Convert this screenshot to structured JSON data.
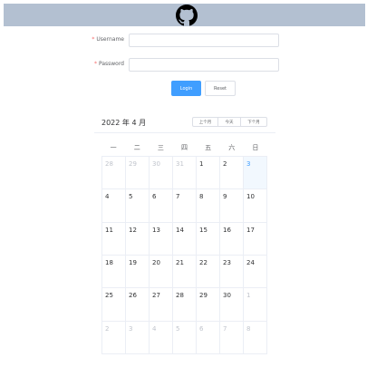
{
  "header": {
    "logo_icon": "github-icon",
    "bg_color": "#b3c0d1"
  },
  "form": {
    "username_label": "Username",
    "password_label": "Password",
    "required_mark": "*",
    "username_value": "",
    "password_value": "",
    "login_label": "Login",
    "reset_label": "Reset"
  },
  "calendar": {
    "title": "2022 年 4 月",
    "prev_label": "上个月",
    "today_label": "今天",
    "next_label": "下个月",
    "weekdays": [
      "一",
      "二",
      "三",
      "四",
      "五",
      "六",
      "日"
    ],
    "days": [
      {
        "d": "28",
        "other": true
      },
      {
        "d": "29",
        "other": true
      },
      {
        "d": "30",
        "other": true
      },
      {
        "d": "31",
        "other": true
      },
      {
        "d": "1"
      },
      {
        "d": "2"
      },
      {
        "d": "3",
        "today": true
      },
      {
        "d": "4"
      },
      {
        "d": "5"
      },
      {
        "d": "6"
      },
      {
        "d": "7"
      },
      {
        "d": "8"
      },
      {
        "d": "9"
      },
      {
        "d": "10"
      },
      {
        "d": "11"
      },
      {
        "d": "12"
      },
      {
        "d": "13"
      },
      {
        "d": "14"
      },
      {
        "d": "15"
      },
      {
        "d": "16"
      },
      {
        "d": "17"
      },
      {
        "d": "18"
      },
      {
        "d": "19"
      },
      {
        "d": "20"
      },
      {
        "d": "21"
      },
      {
        "d": "22"
      },
      {
        "d": "23"
      },
      {
        "d": "24"
      },
      {
        "d": "25"
      },
      {
        "d": "26"
      },
      {
        "d": "27"
      },
      {
        "d": "28"
      },
      {
        "d": "29"
      },
      {
        "d": "30"
      },
      {
        "d": "1",
        "other": true
      },
      {
        "d": "2",
        "other": true
      },
      {
        "d": "3",
        "other": true
      },
      {
        "d": "4",
        "other": true
      },
      {
        "d": "5",
        "other": true
      },
      {
        "d": "6",
        "other": true
      },
      {
        "d": "7",
        "other": true
      },
      {
        "d": "8",
        "other": true
      }
    ],
    "accent_color": "#409eff"
  }
}
